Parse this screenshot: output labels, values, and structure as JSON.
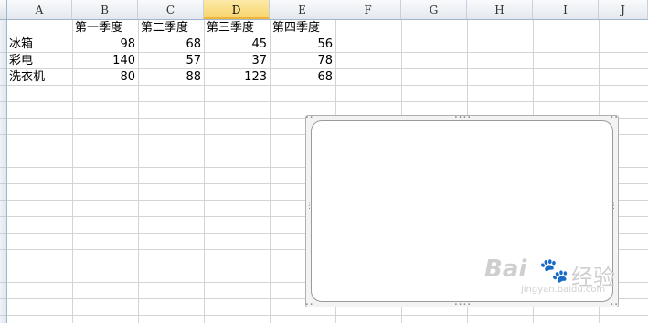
{
  "columns": [
    "A",
    "B",
    "C",
    "D",
    "E",
    "F",
    "G",
    "H",
    "I",
    "J"
  ],
  "active_column": "D",
  "headers": [
    "",
    "第一季度",
    "第二季度",
    "第三季度",
    "第四季度"
  ],
  "rows": [
    {
      "label": "冰箱",
      "values": [
        "98",
        "68",
        "45",
        "56"
      ]
    },
    {
      "label": "彩电",
      "values": [
        "140",
        "57",
        "37",
        "78"
      ]
    },
    {
      "label": "洗衣机",
      "values": [
        "80",
        "88",
        "123",
        "68"
      ]
    }
  ],
  "chart": {
    "handle_glyph": "∙∙∙∙",
    "vhandle_glyph": "⋮"
  },
  "watermark": {
    "brand": "Bai",
    "paw": "🐾",
    "text": "经验",
    "url": "jingyan.baidu.com"
  },
  "colors": {
    "grid": "#d4d4d4",
    "header_bg": "#e4e8ee",
    "active_header": "#f8d56e"
  }
}
